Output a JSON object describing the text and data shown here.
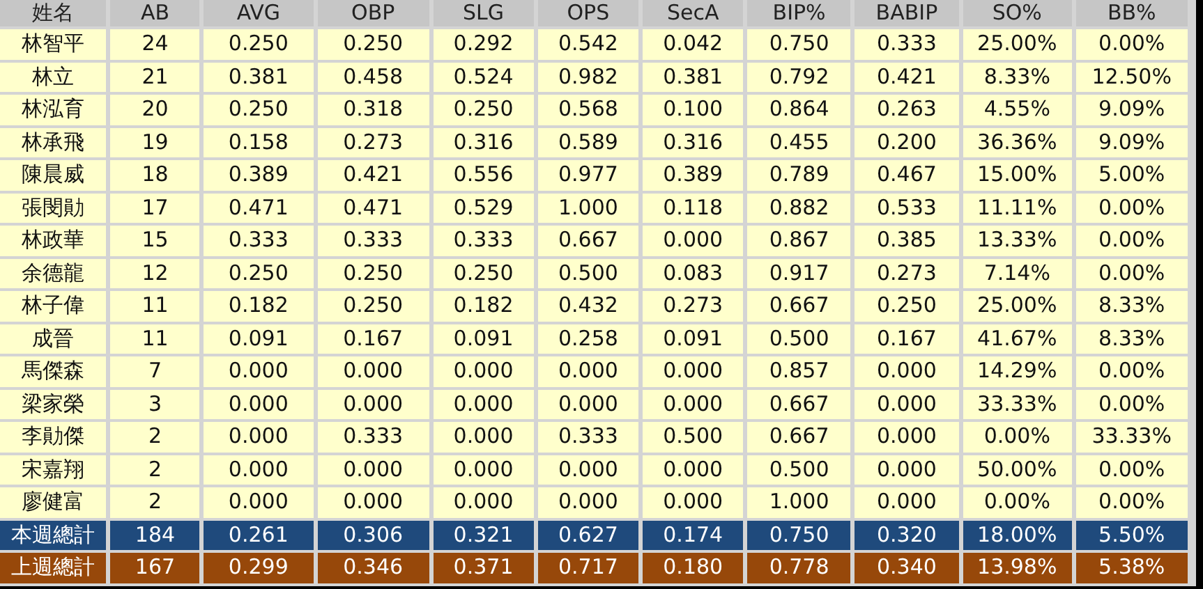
{
  "table": {
    "columns": [
      "姓名",
      "AB",
      "AVG",
      "OBP",
      "SLG",
      "OPS",
      "SecA",
      "BIP%",
      "BABIP",
      "SO%",
      "BB%"
    ],
    "rows": [
      {
        "kind": "player",
        "cells": [
          "林智平",
          "24",
          "0.250",
          "0.250",
          "0.292",
          "0.542",
          "0.042",
          "0.750",
          "0.333",
          "25.00%",
          "0.00%"
        ]
      },
      {
        "kind": "player",
        "cells": [
          "林立",
          "21",
          "0.381",
          "0.458",
          "0.524",
          "0.982",
          "0.381",
          "0.792",
          "0.421",
          "8.33%",
          "12.50%"
        ]
      },
      {
        "kind": "player",
        "cells": [
          "林泓育",
          "20",
          "0.250",
          "0.318",
          "0.250",
          "0.568",
          "0.100",
          "0.864",
          "0.263",
          "4.55%",
          "9.09%"
        ]
      },
      {
        "kind": "player",
        "cells": [
          "林承飛",
          "19",
          "0.158",
          "0.273",
          "0.316",
          "0.589",
          "0.316",
          "0.455",
          "0.200",
          "36.36%",
          "9.09%"
        ]
      },
      {
        "kind": "player",
        "cells": [
          "陳晨威",
          "18",
          "0.389",
          "0.421",
          "0.556",
          "0.977",
          "0.389",
          "0.789",
          "0.467",
          "15.00%",
          "5.00%"
        ]
      },
      {
        "kind": "player",
        "cells": [
          "張閔勛",
          "17",
          "0.471",
          "0.471",
          "0.529",
          "1.000",
          "0.118",
          "0.882",
          "0.533",
          "11.11%",
          "0.00%"
        ]
      },
      {
        "kind": "player",
        "cells": [
          "林政華",
          "15",
          "0.333",
          "0.333",
          "0.333",
          "0.667",
          "0.000",
          "0.867",
          "0.385",
          "13.33%",
          "0.00%"
        ]
      },
      {
        "kind": "player",
        "cells": [
          "余德龍",
          "12",
          "0.250",
          "0.250",
          "0.250",
          "0.500",
          "0.083",
          "0.917",
          "0.273",
          "7.14%",
          "0.00%"
        ]
      },
      {
        "kind": "player",
        "cells": [
          "林子偉",
          "11",
          "0.182",
          "0.250",
          "0.182",
          "0.432",
          "0.273",
          "0.667",
          "0.250",
          "25.00%",
          "8.33%"
        ]
      },
      {
        "kind": "player",
        "cells": [
          "成晉",
          "11",
          "0.091",
          "0.167",
          "0.091",
          "0.258",
          "0.091",
          "0.500",
          "0.167",
          "41.67%",
          "8.33%"
        ]
      },
      {
        "kind": "player",
        "cells": [
          "馬傑森",
          "7",
          "0.000",
          "0.000",
          "0.000",
          "0.000",
          "0.000",
          "0.857",
          "0.000",
          "14.29%",
          "0.00%"
        ]
      },
      {
        "kind": "player",
        "cells": [
          "梁家榮",
          "3",
          "0.000",
          "0.000",
          "0.000",
          "0.000",
          "0.000",
          "0.667",
          "0.000",
          "33.33%",
          "0.00%"
        ]
      },
      {
        "kind": "player",
        "cells": [
          "李勛傑",
          "2",
          "0.000",
          "0.333",
          "0.000",
          "0.333",
          "0.500",
          "0.667",
          "0.000",
          "0.00%",
          "33.33%"
        ]
      },
      {
        "kind": "player",
        "cells": [
          "宋嘉翔",
          "2",
          "0.000",
          "0.000",
          "0.000",
          "0.000",
          "0.000",
          "0.500",
          "0.000",
          "50.00%",
          "0.00%"
        ]
      },
      {
        "kind": "player",
        "cells": [
          "廖健富",
          "2",
          "0.000",
          "0.000",
          "0.000",
          "0.000",
          "0.000",
          "1.000",
          "0.000",
          "0.00%",
          "0.00%"
        ]
      },
      {
        "kind": "this_week_total",
        "cells": [
          "本週總計",
          "184",
          "0.261",
          "0.306",
          "0.321",
          "0.627",
          "0.174",
          "0.750",
          "0.320",
          "18.00%",
          "5.50%"
        ]
      },
      {
        "kind": "last_week_total",
        "cells": [
          "上週總計",
          "167",
          "0.299",
          "0.346",
          "0.371",
          "0.717",
          "0.180",
          "0.778",
          "0.340",
          "13.98%",
          "5.38%"
        ]
      }
    ]
  }
}
